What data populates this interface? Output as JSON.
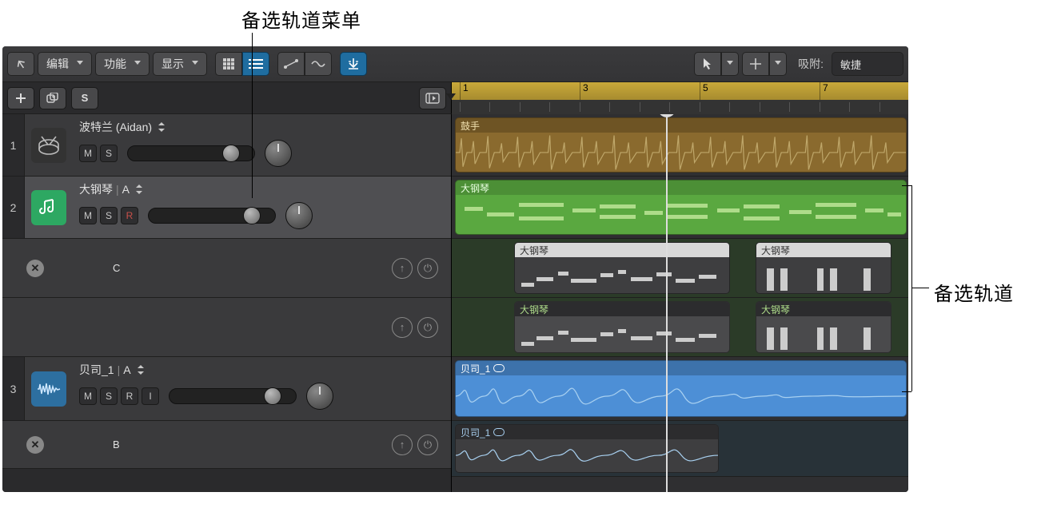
{
  "annotations": {
    "top": "备选轨道菜单",
    "right": "备选轨道"
  },
  "toolbar": {
    "edit": "编辑",
    "functions": "功能",
    "view": "显示",
    "snap_label": "吸附:",
    "snap_value": "敏捷"
  },
  "header": {
    "solo": "S"
  },
  "ruler": {
    "bars": [
      "1",
      "3",
      "5",
      "7"
    ]
  },
  "tracks": [
    {
      "num": "1",
      "type": "drums",
      "name": "波特兰 (Aidan)",
      "ms": {
        "m": "M",
        "s": "S"
      },
      "region": {
        "label": "鼓手"
      }
    },
    {
      "num": "2",
      "type": "midi",
      "name": "大钢琴",
      "take": "A",
      "ms": {
        "m": "M",
        "s": "S",
        "r": "R"
      },
      "selected": true,
      "region": {
        "label": "大钢琴"
      },
      "alts": [
        {
          "label": "C",
          "regions": [
            {
              "label": "大钢琴"
            },
            {
              "label": "大钢琴"
            }
          ]
        },
        {
          "label": "",
          "regions": [
            {
              "label": "大钢琴"
            },
            {
              "label": "大钢琴"
            }
          ]
        }
      ]
    },
    {
      "num": "3",
      "type": "audio",
      "name": "贝司_1",
      "take": "A",
      "ms": {
        "m": "M",
        "s": "S",
        "r": "R",
        "i": "I"
      },
      "region": {
        "label": "贝司_1"
      },
      "alts": [
        {
          "label": "B",
          "regions": [
            {
              "label": "贝司_1"
            }
          ]
        }
      ]
    }
  ]
}
